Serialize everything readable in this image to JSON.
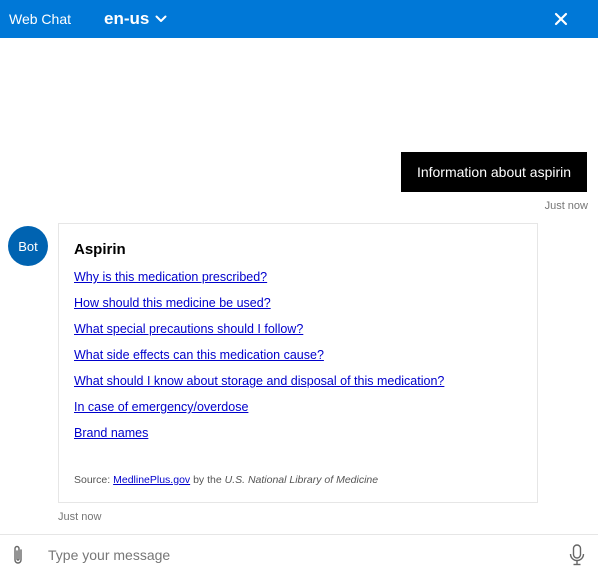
{
  "header": {
    "title": "Web Chat",
    "language": "en-us",
    "icons": {
      "language_dropdown": "chevron-down-icon",
      "close": "close-icon"
    }
  },
  "colors": {
    "header_bg": "#0078d7",
    "user_bubble_bg": "#000000",
    "avatar_bg": "#0063b1",
    "link": "#0000cc",
    "timestamp": "#767676"
  },
  "transcript": {
    "user_message": {
      "text": "Information about aspirin",
      "timestamp": "Just now"
    },
    "bot_message": {
      "avatar_initials": "Bot",
      "timestamp": "Just now",
      "card": {
        "title": "Aspirin",
        "links": [
          "Why is this medication prescribed?",
          "How should this medicine be used?",
          "What special precautions should I follow?",
          "What side effects can this medication cause?",
          "What should I know about storage and disposal of this medication?",
          "In case of emergency/overdose",
          "Brand names"
        ],
        "source": {
          "prefix": "Source: ",
          "link_text": "MedlinePlus.gov",
          "middle": " by the ",
          "org": "U.S. National Library of Medicine"
        }
      }
    }
  },
  "sendbox": {
    "placeholder": "Type your message",
    "value": "",
    "icons": {
      "attach": "paperclip-icon",
      "microphone": "microphone-icon"
    }
  }
}
